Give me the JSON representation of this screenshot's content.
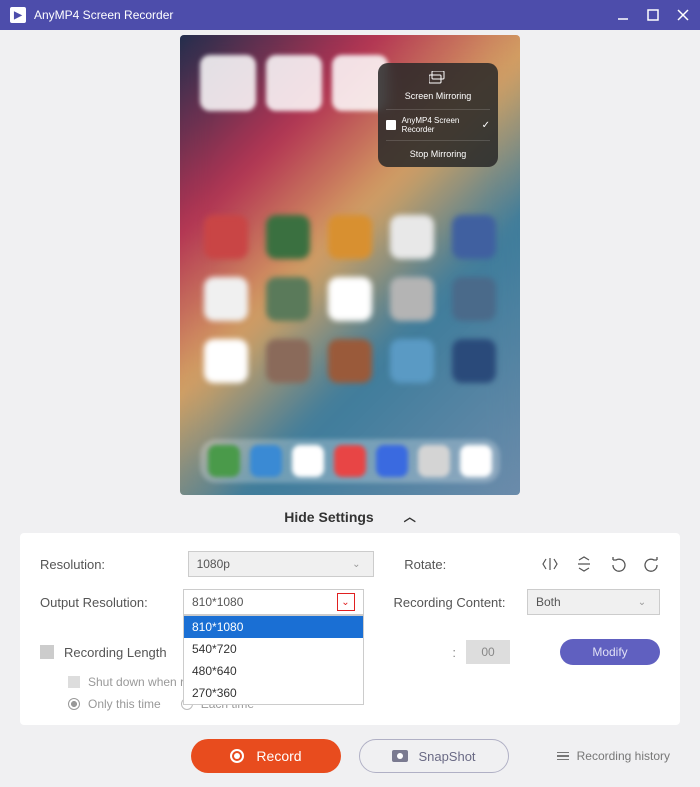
{
  "titlebar": {
    "app_name": "AnyMP4 Screen Recorder"
  },
  "mirror_card": {
    "title": "Screen Mirroring",
    "device": "AnyMP4 Screen Recorder",
    "stop": "Stop Mirroring"
  },
  "hide_settings": {
    "label": "Hide Settings"
  },
  "settings": {
    "resolution_label": "Resolution:",
    "resolution_value": "1080p",
    "output_res_label": "Output Resolution:",
    "output_res_value": "810*1080",
    "output_res_options": [
      "810*1080",
      "540*720",
      "480*640",
      "270*360"
    ],
    "rotate_label": "Rotate:",
    "recording_content_label": "Recording Content:",
    "recording_content_value": "Both",
    "rec_length_label": "Recording Length",
    "time_seg": "00",
    "modify": "Modify",
    "shutdown": "Shut down when recording ends",
    "only_time": "Only this time",
    "each_time": "Each time"
  },
  "bottom": {
    "record": "Record",
    "snapshot": "SnapShot",
    "history": "Recording history"
  }
}
